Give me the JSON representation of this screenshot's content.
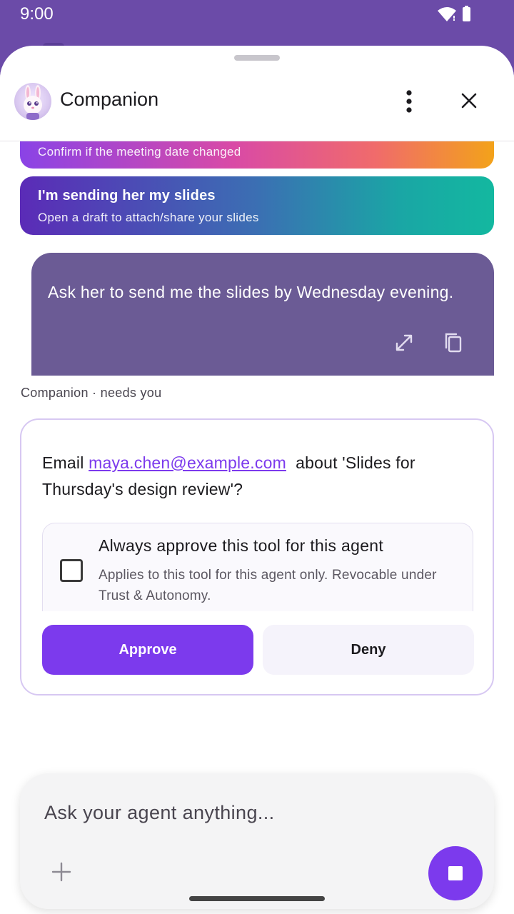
{
  "status_bar": {
    "time": "9:00"
  },
  "header": {
    "title": "Companion"
  },
  "suggestions": [
    {
      "title": "",
      "subtitle": "Confirm if the meeting date changed"
    },
    {
      "title": "I'm sending her my slides",
      "subtitle": "Open a draft to attach/share your slides"
    }
  ],
  "user_message": {
    "text": "Ask her to send me the slides by Wednesday evening."
  },
  "agent_status": "Companion · needs you",
  "approval": {
    "question_prefix": "Email",
    "email": "maya.chen@example.com",
    "question_suffix": "about 'Slides for Thursday's design review'?",
    "always_title": "Always approve this tool for this agent",
    "always_desc": "Applies to this tool for this agent only. Revocable under Trust & Autonomy.",
    "always_checked": false,
    "approve_label": "Approve",
    "deny_label": "Deny"
  },
  "composer": {
    "placeholder": "Ask your agent anything..."
  },
  "colors": {
    "primary": "#7c3aed",
    "status_bar": "#6b4ba8",
    "user_bubble": "#6b5b95"
  }
}
